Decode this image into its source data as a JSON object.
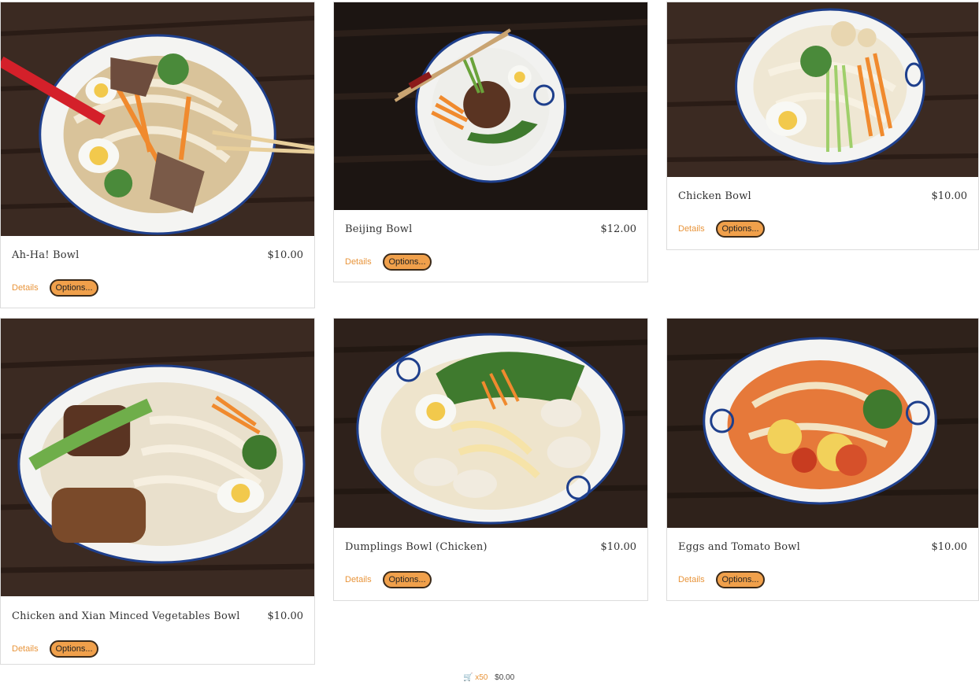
{
  "products": [
    {
      "name": "Ah-Ha! Bowl",
      "price": "$10.00",
      "details_label": "Details",
      "options_label": "Options..."
    },
    {
      "name": "Beijing Bowl",
      "price": "$12.00",
      "details_label": "Details",
      "options_label": "Options..."
    },
    {
      "name": "Chicken Bowl",
      "price": "$10.00",
      "details_label": "Details",
      "options_label": "Options..."
    },
    {
      "name": "Chicken and Xian Minced Vegetables Bowl",
      "price": "$10.00",
      "details_label": "Details",
      "options_label": "Options..."
    },
    {
      "name": "Dumplings Bowl (Chicken)",
      "price": "$10.00",
      "details_label": "Details",
      "options_label": "Options..."
    },
    {
      "name": "Eggs and Tomato Bowl",
      "price": "$10.00",
      "details_label": "Details",
      "options_label": "Options..."
    }
  ],
  "cart": {
    "icon": "cart-icon",
    "count": "x50",
    "total": "$0.00"
  },
  "colors": {
    "accent": "#e8943a",
    "button": "#f0a04b",
    "table": "#3b2a22"
  }
}
